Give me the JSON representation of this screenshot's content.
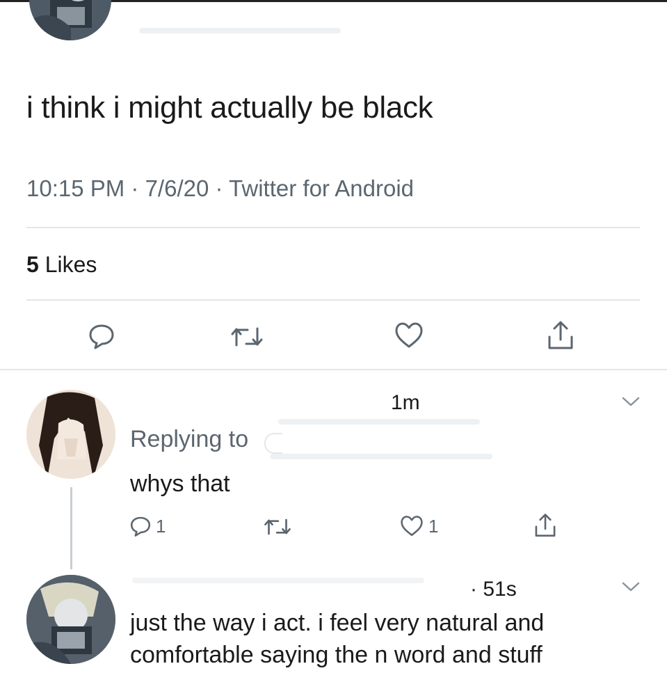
{
  "tweet": {
    "text": "i think i might actually be black",
    "meta": "10:15 PM · 7/6/20 · Twitter for Android",
    "likes_count": "5",
    "likes_label": "Likes",
    "actions": [
      "reply-icon",
      "retweet-icon",
      "like-icon",
      "share-icon"
    ]
  },
  "replies": [
    {
      "time": "1m",
      "replying_label": "Replying to",
      "text": "whys that",
      "reply_count": "1",
      "like_count": "1"
    },
    {
      "time": "· 51s",
      "text_line1": "just the way i act. i feel very natural and",
      "text_line2": "comfortable saying the n word and stuff"
    }
  ],
  "colors": {
    "text": "#1a1a1a",
    "secondary": "#5b6670",
    "divider": "#e3e6e8"
  }
}
